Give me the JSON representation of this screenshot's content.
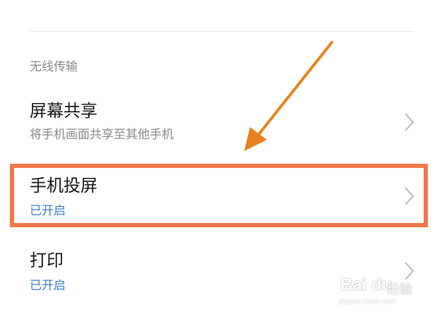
{
  "section": {
    "header": "无线传输"
  },
  "rows": [
    {
      "title": "屏幕共享",
      "subtitle": "将手机画面共享至其他手机",
      "subtitle_color": "#8a8a8a"
    },
    {
      "title": "手机投屏",
      "subtitle": "已开启",
      "subtitle_color": "#3f7fd4"
    },
    {
      "title": "打印",
      "subtitle": "已开启",
      "subtitle_color": "#3f7fd4"
    }
  ],
  "icons": {
    "chevron": "chevron-right-icon",
    "arrow": "arrow-annotation-icon"
  },
  "annotation": {
    "highlight_color": "#f07848",
    "arrow_color": "#e8821e"
  },
  "watermark": {
    "brand": "Bai du",
    "label": "经验",
    "url": "jingyan.baidu.com"
  }
}
